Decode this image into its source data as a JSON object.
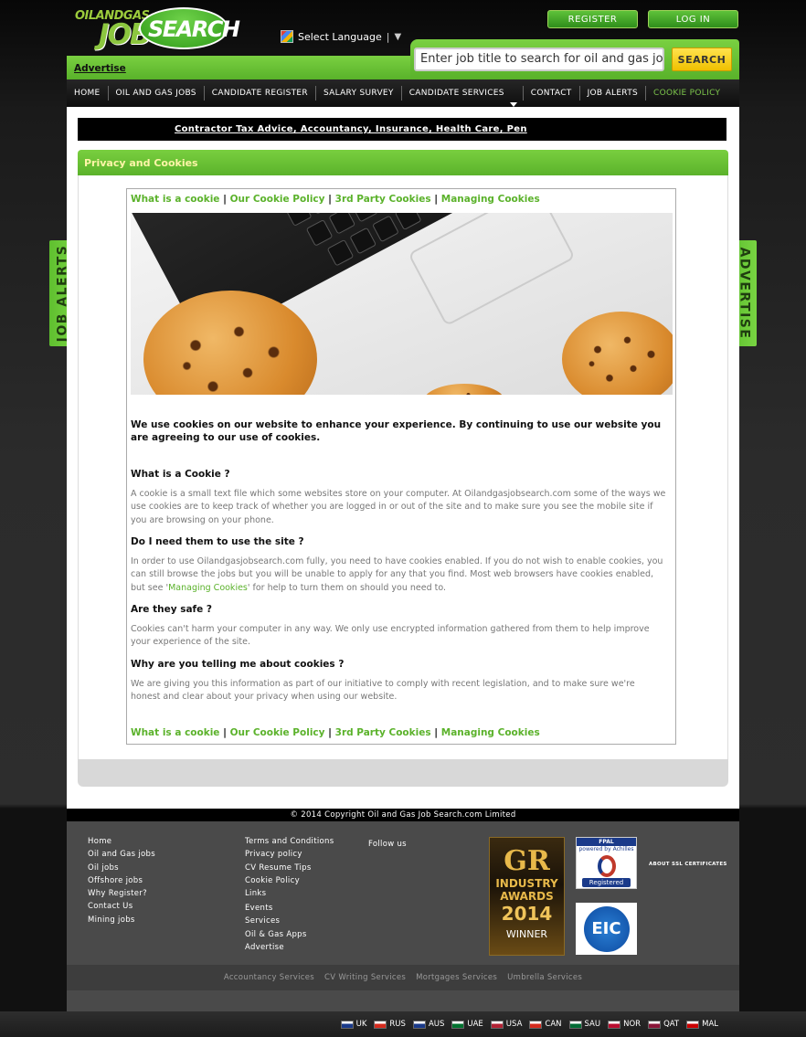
{
  "header": {
    "logo": {
      "small": "OILANDGAS",
      "job": "JOB",
      "search": "SEARCH"
    },
    "language": {
      "label": "Select Language",
      "separator": "|",
      "arrow": "▼"
    },
    "register_label": "REGISTER",
    "login_label": "LOG IN",
    "advertise_label": "Advertise",
    "search_placeholder": "Enter job title to search for oil and gas jobs",
    "search_button": "SEARCH"
  },
  "nav": [
    "HOME",
    "OIL AND GAS JOBS",
    "CANDIDATE REGISTER",
    "SALARY SURVEY",
    "CANDIDATE SERVICES",
    "CONTACT",
    "JOB ALERTS",
    "COOKIE POLICY"
  ],
  "side": {
    "left": "JOB ALERTS",
    "right": "ADVERTISE"
  },
  "ticker": "Contractor Tax Advice, Accountancy, Insurance, Health Care, Pen",
  "panel_title": "Privacy and Cookies",
  "page_links": [
    "What is a cookie",
    "Our Cookie Policy",
    "3rd Party Cookies",
    "Managing Cookies"
  ],
  "link_separator": "|",
  "intro": "We use cookies on our website to enhance your experience. By continuing to use our website you are agreeing to our use of cookies.",
  "sections": [
    {
      "heading": "What is a Cookie ?",
      "text": "A cookie is a small text file which some websites store on your computer. At Oilandgasjobsearch.com some of the ways we use cookies are to keep track of whether you are logged in or out of the site and to make sure you see the mobile site if you are browsing on your phone."
    },
    {
      "heading": "Do I need them to use the site ?",
      "text_before": "In order to use Oilandgasjobsearch.com fully, you need to have cookies enabled. If you do not wish to enable cookies, you can still browse the jobs but you will be unable to apply for any that you find. Most web browsers have cookies enabled, but see '",
      "link": "Managing Cookies",
      "text_after": "' for help to turn them on should you need to."
    },
    {
      "heading": "Are they safe ?",
      "text": "Cookies can't harm your computer in any way. We only use encrypted information gathered from them to help improve your experience of the site."
    },
    {
      "heading": "Why are you telling me about cookies ?",
      "text": "We are giving you this information as part of our initiative to comply with recent legislation, and to make sure we're honest and clear about your privacy when using our website."
    }
  ],
  "footer": {
    "copyright": "© 2014 Copyright Oil and Gas Job Search.com Limited",
    "col1": [
      "Home",
      "Oil and Gas jobs",
      "Oil jobs",
      "Offshore jobs",
      "Why Register?",
      "Contact Us",
      "Mining jobs"
    ],
    "col2a": [
      "Terms and Conditions",
      "Privacy policy",
      "CV Resume Tips",
      "Cookie Policy",
      "Links"
    ],
    "col2b": [
      "Events",
      "Services",
      "Oil & Gas Apps",
      "Advertise"
    ],
    "follow": "Follow us",
    "award": {
      "gr": "GR",
      "line1": "INDUSTRY",
      "line2": "AWARDS",
      "year": "2014",
      "winner": "WINNER"
    },
    "fpal": {
      "top": "FPAL",
      "sub": "powered by Achilles",
      "registered": "Registered"
    },
    "ssl": "ABOUT SSL CERTIFICATES",
    "eic": "EIC",
    "services": [
      "Accountancy Services",
      "CV Writing Services",
      "Mortgages Services",
      "Umbrella Services"
    ]
  },
  "countries": [
    {
      "code": "UK",
      "color": "#1a3a8a"
    },
    {
      "code": "RUS",
      "color": "#d52b1e"
    },
    {
      "code": "AUS",
      "color": "#1a3a8a"
    },
    {
      "code": "UAE",
      "color": "#00732f"
    },
    {
      "code": "USA",
      "color": "#b22234"
    },
    {
      "code": "CAN",
      "color": "#d52b1e"
    },
    {
      "code": "SAU",
      "color": "#006c35"
    },
    {
      "code": "NOR",
      "color": "#ba0c2f"
    },
    {
      "code": "QAT",
      "color": "#8a1538"
    },
    {
      "code": "MAL",
      "color": "#cc0001"
    }
  ]
}
